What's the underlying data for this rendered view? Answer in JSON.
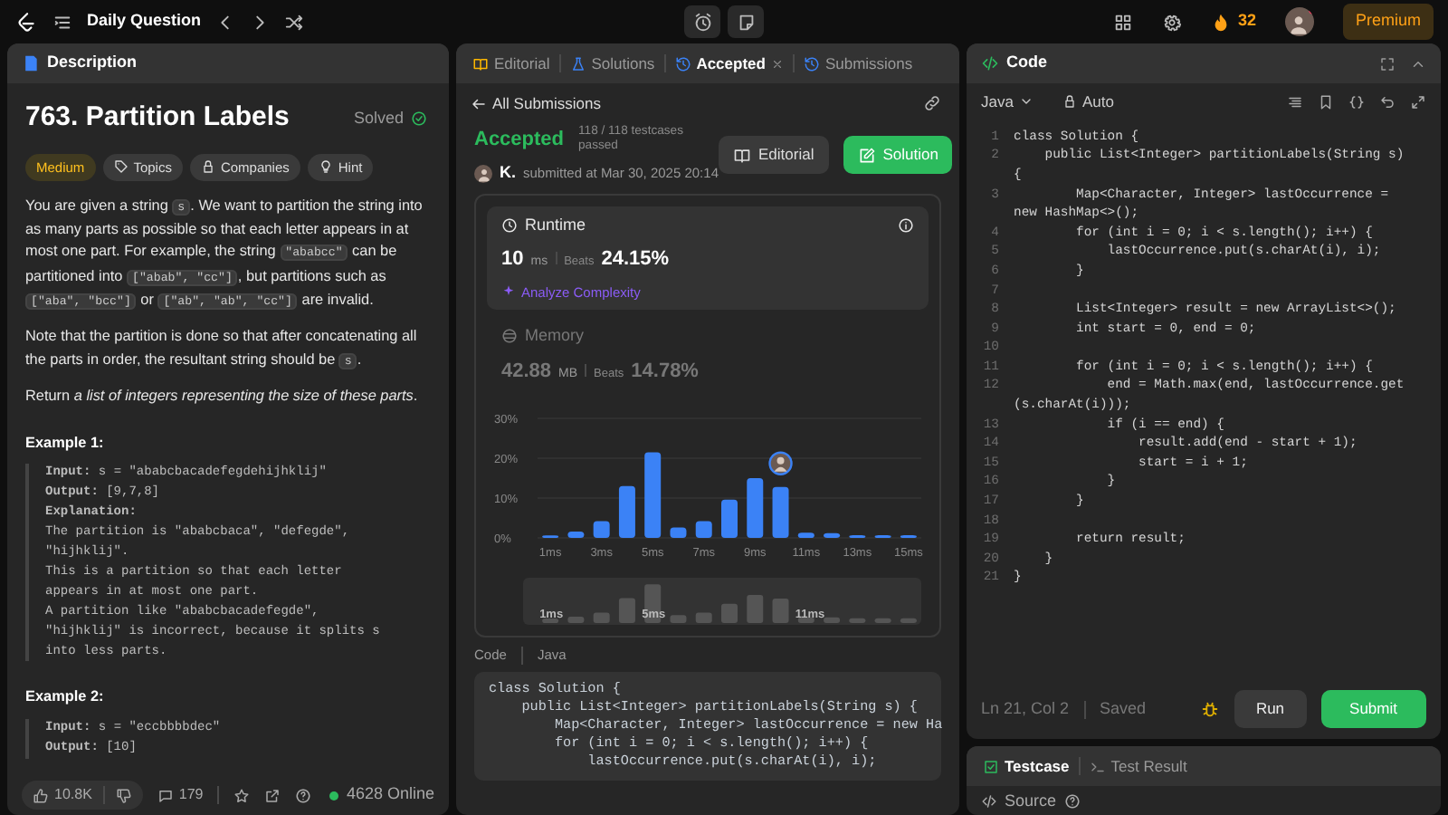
{
  "top_bar": {
    "title": "Daily Question",
    "streak": "32",
    "premium": "Premium"
  },
  "description_panel": {
    "tab": "Description",
    "title": "763. Partition Labels",
    "status": "Solved",
    "tags": [
      {
        "kind": "difficulty",
        "label": "Medium"
      },
      {
        "kind": "topics",
        "label": "Topics"
      },
      {
        "kind": "companies",
        "label": "Companies"
      },
      {
        "kind": "hint",
        "label": "Hint"
      }
    ],
    "paragraphs": [
      [
        {
          "kind": "text",
          "text": "You are given a string "
        },
        {
          "kind": "code",
          "text": "s"
        },
        {
          "kind": "text",
          "text": ". We want to partition the string into as many parts as possible so that each letter appears in at most one part. For example, the string "
        },
        {
          "kind": "code",
          "text": "\"ababcc\""
        },
        {
          "kind": "text",
          "text": " can be partitioned into "
        },
        {
          "kind": "code",
          "text": "[\"abab\", \"cc\"]"
        },
        {
          "kind": "text",
          "text": ", but partitions such as "
        },
        {
          "kind": "code",
          "text": "[\"aba\", \"bcc\"]"
        },
        {
          "kind": "text",
          "text": " or "
        },
        {
          "kind": "code",
          "text": "[\"ab\", \"ab\", \"cc\"]"
        },
        {
          "kind": "text",
          "text": " are invalid."
        }
      ],
      [
        {
          "kind": "text",
          "text": "Note that the partition is done so that after concatenating all the parts in order, the resultant string should be "
        },
        {
          "kind": "code",
          "text": "s"
        },
        {
          "kind": "text",
          "text": "."
        }
      ],
      [
        {
          "kind": "text",
          "text": "Return *a list of integers representing the size of these parts*."
        }
      ]
    ],
    "examples": [
      {
        "heading": "Example 1:",
        "lines": [
          "**Input:** s = \"ababcbacadefegdehijhklij\"",
          "**Output:** [9,7,8]",
          "**Explanation:**",
          "The partition is \"ababcbaca\", \"defegde\",",
          "\"hijhklij\".",
          "This is a partition so that each letter",
          "appears in at most one part.",
          "A partition like \"ababcbacadefegde\",",
          "\"hijhklij\" is incorrect, because it splits s",
          "into less parts."
        ]
      },
      {
        "heading": "Example 2:",
        "lines": [
          "**Input:** s = \"eccbbbbdec\"",
          "**Output:** [10]"
        ]
      }
    ],
    "footer": {
      "likes": "10.8K",
      "comments": "179",
      "online": "4628 Online"
    }
  },
  "result_panel": {
    "tabs": [
      {
        "kind": "editorial",
        "label": "Editorial",
        "selected": false,
        "closable": false
      },
      {
        "kind": "solutions",
        "label": "Solutions",
        "selected": false,
        "closable": false
      },
      {
        "kind": "accepted",
        "label": "Accepted",
        "selected": true,
        "closable": true
      },
      {
        "kind": "submissions",
        "label": "Submissions",
        "selected": false,
        "closable": false
      }
    ],
    "back": "All Submissions",
    "status": "Accepted",
    "testcases": "118 / 118 testcases passed",
    "user": "K.",
    "submitted": "submitted at Mar 30, 2025 20:14",
    "buttons": [
      {
        "kind": "editorial",
        "label": "Editorial"
      },
      {
        "kind": "solution",
        "label": "Solution"
      }
    ],
    "stats": [
      {
        "kind": "runtime",
        "label": "Runtime",
        "value": "10",
        "unit": "ms",
        "beats_label": "Beats",
        "beats": "24.15%",
        "selected": true,
        "action": "Analyze Complexity"
      },
      {
        "kind": "memory",
        "label": "Memory",
        "value": "42.88",
        "unit": "MB",
        "beats_label": "Beats",
        "beats": "14.78%",
        "selected": false
      }
    ],
    "chart_data": {
      "type": "bar",
      "x": [
        1,
        2,
        3,
        4,
        5,
        6,
        7,
        8,
        9,
        10,
        11,
        12,
        13,
        14,
        15
      ],
      "values": [
        0.6,
        1.6,
        4.2,
        13,
        21.5,
        2.6,
        4.2,
        9.6,
        15,
        12.8,
        1.3,
        1.2,
        0.7,
        0.7,
        0.7
      ],
      "xlim": [
        0.5,
        15.5
      ],
      "ylim": [
        0,
        30
      ],
      "yticks": [
        {
          "value": 0,
          "label": "0%"
        },
        {
          "value": 10,
          "label": "10%"
        },
        {
          "value": 20,
          "label": "20%"
        },
        {
          "value": 30,
          "label": "30%"
        }
      ],
      "xticks": [
        {
          "value": 1,
          "label": "1ms"
        },
        {
          "value": 3,
          "label": "3ms"
        },
        {
          "value": 5,
          "label": "5ms"
        },
        {
          "value": 7,
          "label": "7ms"
        },
        {
          "value": 9,
          "label": "9ms"
        },
        {
          "value": 11,
          "label": "11ms"
        },
        {
          "value": 13,
          "label": "13ms"
        },
        {
          "value": 15,
          "label": "15ms"
        }
      ]
    },
    "overview_labels": [
      "1ms",
      "5ms",
      "11ms"
    ],
    "code_label": "Code",
    "code_language": "Java",
    "code_lines": [
      "class Solution {",
      "    public List<Integer> partitionLabels(String s) {",
      "        Map<Character, Integer> lastOccurrence = new Ha",
      "        for (int i = 0; i < s.length(); i++) {",
      "            lastOccurrence.put(s.charAt(i), i);"
    ]
  },
  "editor_panel": {
    "title": "Code",
    "language": "Java",
    "mode": "Auto",
    "lines": [
      {
        "n": "1",
        "rows": [
          "class Solution {"
        ]
      },
      {
        "n": "2",
        "rows": [
          "    public List<Integer> partitionLabels(String s)",
          "{"
        ]
      },
      {
        "n": "3",
        "rows": [
          "        Map<Character, Integer> lastOccurrence =",
          "new HashMap<>();"
        ]
      },
      {
        "n": "4",
        "rows": [
          "        for (int i = 0; i < s.length(); i++) {"
        ]
      },
      {
        "n": "5",
        "rows": [
          "            lastOccurrence.put(s.charAt(i), i);"
        ]
      },
      {
        "n": "6",
        "rows": [
          "        }"
        ]
      },
      {
        "n": "7"
      },
      {
        "n": "8",
        "rows": [
          "        List<Integer> result = new ArrayList<>();"
        ]
      },
      {
        "n": "9",
        "rows": [
          "        int start = 0, end = 0;"
        ]
      },
      {
        "n": "10"
      },
      {
        "n": "11",
        "rows": [
          "        for (int i = 0; i < s.length(); i++) {"
        ]
      },
      {
        "n": "12",
        "rows": [
          "            end = Math.max(end, lastOccurrence.get",
          "(s.charAt(i)));"
        ]
      },
      {
        "n": "13",
        "rows": [
          "            if (i == end) {"
        ]
      },
      {
        "n": "14",
        "rows": [
          "                result.add(end - start + 1);"
        ]
      },
      {
        "n": "15",
        "rows": [
          "                start = i + 1;"
        ]
      },
      {
        "n": "16",
        "rows": [
          "            }"
        ]
      },
      {
        "n": "17",
        "rows": [
          "        }"
        ]
      },
      {
        "n": "18"
      },
      {
        "n": "19",
        "rows": [
          "        return result;"
        ]
      },
      {
        "n": "20",
        "rows": [
          "    }"
        ]
      },
      {
        "n": "21",
        "rows": [
          "}"
        ]
      }
    ],
    "cursor": "Ln 21, Col 2",
    "save_state": "Saved",
    "run": "Run",
    "submit": "Submit"
  },
  "console_panel": {
    "tabs": [
      {
        "kind": "testcase",
        "label": "Testcase",
        "selected": true
      },
      {
        "kind": "result",
        "label": "Test Result",
        "selected": false
      }
    ],
    "source": "Source"
  }
}
